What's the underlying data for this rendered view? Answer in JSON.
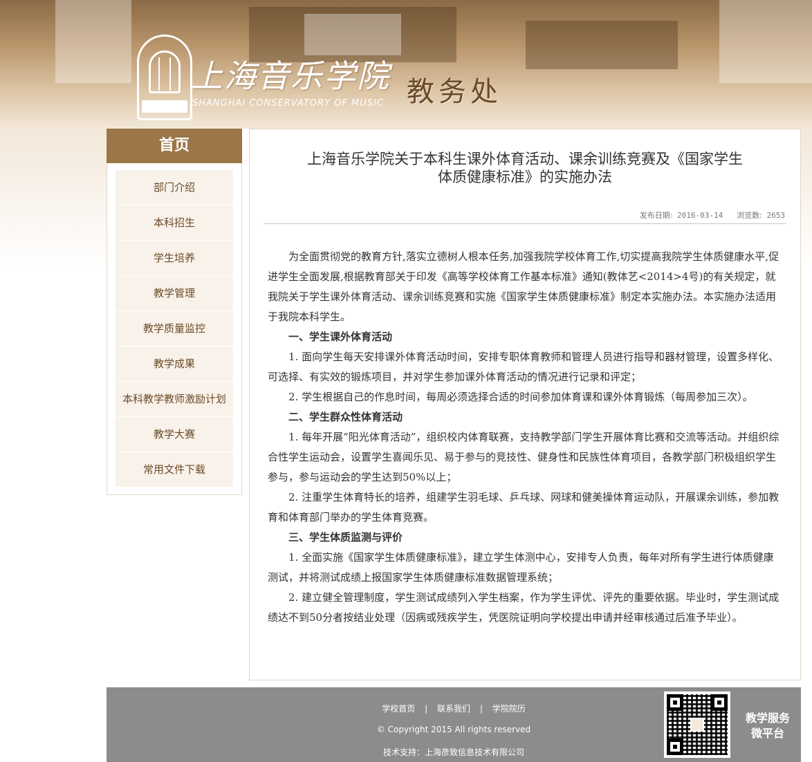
{
  "header": {
    "school_name_cn": "上海音乐学院",
    "school_name_en": "SHANGHAI CONSERVATORY OF MUSIC",
    "department": "教务处"
  },
  "sidebar": {
    "home_label": "首页",
    "items": [
      {
        "label": "部门介绍"
      },
      {
        "label": "本科招生"
      },
      {
        "label": "学生培养"
      },
      {
        "label": "教学管理"
      },
      {
        "label": "教学质量监控"
      },
      {
        "label": "教学成果"
      },
      {
        "label": "本科教学教师激励计划"
      },
      {
        "label": "教学大赛"
      },
      {
        "label": "常用文件下载"
      }
    ]
  },
  "article": {
    "title_line1": "上海音乐学院关于本科生课外体育活动、课余训练竞赛及《国家学生",
    "title_line2": "体质健康标准》的实施办法",
    "publish_label": "发布日期:",
    "publish_date": "2016-03-14",
    "views_label": "浏览数:",
    "views": "2653",
    "paragraphs": [
      "为全面贯彻党的教育方针,落实立德树人根本任务,加强我院学校体育工作,切实提高我院学生体质健康水平,促进学生全面发展,根据教育部关于印发《高等学校体育工作基本标准》通知(教体艺<2014>4号)的有关规定，就我院关于学生课外体育活动、课余训练竞赛和实施《国家学生体质健康标准》制定本实施办法。本实施办法适用于我院本科学生。",
      "一、学生课外体育活动",
      "1. 面向学生每天安排课外体育活动时间，安排专职体育教师和管理人员进行指导和器材管理，设置多样化、可选择、有实效的锻炼项目，并对学生参加课外体育活动的情况进行记录和评定；",
      "2. 学生根据自己的作息时间，每周必须选择合适的时间参加体育课和课外体育锻炼（每周参加三次）。",
      "二、学生群众性体育活动",
      "1. 每年开展“阳光体育活动”，组织校内体育联赛，支持教学部门学生开展体育比赛和交流等活动。并组织综合性学生运动会，设置学生喜闻乐见、易于参与的竞技性、健身性和民族性体育项目，各教学部门积极组织学生参与，参与运动会的学生达到50%以上；",
      "2. 注重学生体育特长的培养，组建学生羽毛球、乒乓球、网球和健美操体育运动队，开展课余训练，参加教育和体育部门举办的学生体育竞赛。",
      "三、学生体质监测与评价",
      "1. 全面实施《国家学生体质健康标准》，建立学生体测中心，安排专人负责，每年对所有学生进行体质健康测试，并将测试成绩上报国家学生体质健康标准数据管理系统；",
      "2. 建立健全管理制度，学生测试成绩列入学生档案，作为学生评优、评先的重要依据。毕业时，学生测试成绩达不到50分者按结业处理（因病或残疾学生，凭医院证明向学校提出申请并经审核通过后准予毕业）。"
    ]
  },
  "footer": {
    "links": [
      "学校首页",
      "联系我们",
      "学院院历"
    ],
    "separator": "|",
    "copyright": "© Copyright 2015 All rights reserved",
    "tech_support": "技术支持：上海彦致信息技术有限公司",
    "wechat_line1": "教学服务",
    "wechat_line2": "微平台"
  }
}
